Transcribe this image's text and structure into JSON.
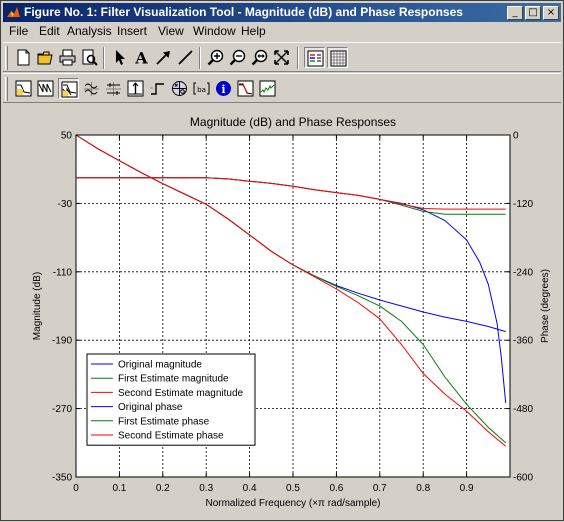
{
  "window": {
    "title": "Figure No. 1: Filter Visualization Tool - Magnitude (dB) and Phase Responses",
    "min_label": "_",
    "max_label": "□",
    "close_label": "×"
  },
  "menu": {
    "items": [
      {
        "label": "File"
      },
      {
        "label": "Edit"
      },
      {
        "label": "Analysis"
      },
      {
        "label": "Insert"
      },
      {
        "label": "View"
      },
      {
        "label": "Window"
      },
      {
        "label": "Help"
      }
    ]
  },
  "toolbar1": [
    "new-figure-icon",
    "open-file-icon",
    "print-icon",
    "print-preview-icon",
    "select-arrow-icon",
    "insert-text-icon",
    "insert-arrow-icon",
    "insert-line-icon",
    "zoom-in-icon",
    "zoom-out-icon",
    "zoom-x-icon",
    "full-view-icon",
    "legend-icon",
    "grid-icon"
  ],
  "toolbar2": [
    "magnitude-response-icon",
    "phase-response-icon",
    "magnitude-phase-icon",
    "group-delay-icon",
    "phase-delay-icon",
    "impulse-response-icon",
    "step-response-icon",
    "pole-zero-icon",
    "coefficients-icon",
    "filter-info-icon",
    "magnitude-estimate-icon",
    "noise-power-icon"
  ],
  "colors": {
    "original": "#0000ff",
    "first": "#008000",
    "second": "#ff0000"
  },
  "chart_data": {
    "type": "line",
    "title": "Magnitude (dB) and Phase Responses",
    "xlabel": "Normalized Frequency (×π rad/sample)",
    "ylabel": "Magnitude (dB)",
    "ylabel_right": "Phase (degrees)",
    "xlim": [
      0,
      1
    ],
    "ylim": [
      -350,
      50
    ],
    "ylim_right": [
      -600,
      0
    ],
    "xticks": [
      "0",
      "0.1",
      "0.2",
      "0.3",
      "0.4",
      "0.5",
      "0.6",
      "0.7",
      "0.8",
      "0.9"
    ],
    "yticks_left": [
      "50",
      "-30",
      "-110",
      "-190",
      "-270",
      "-350"
    ],
    "yticks_right": [
      "0",
      "-120",
      "-240",
      "-360",
      "-480",
      "-600"
    ],
    "grid": true,
    "legend_position": "bottom-left",
    "series": [
      {
        "name": "Original magnitude",
        "axis": "left",
        "color": "#0000ff",
        "x": [
          0,
          0.05,
          0.1,
          0.15,
          0.2,
          0.25,
          0.3,
          0.35,
          0.4,
          0.45,
          0.5,
          0.55,
          0.6,
          0.65,
          0.7,
          0.75,
          0.8,
          0.85,
          0.9,
          0.95,
          0.99
        ],
        "y": [
          50,
          34,
          20,
          6,
          -7,
          -19,
          -31,
          -48,
          -67,
          -86,
          -102,
          -115,
          -126,
          -135,
          -143,
          -150,
          -157,
          -163,
          -168,
          -174,
          -180
        ]
      },
      {
        "name": "First  Estimate magnitude",
        "axis": "left",
        "color": "#008000",
        "x": [
          0,
          0.05,
          0.1,
          0.15,
          0.2,
          0.25,
          0.3,
          0.35,
          0.4,
          0.45,
          0.5,
          0.55,
          0.6,
          0.65,
          0.7,
          0.75,
          0.8,
          0.85,
          0.9,
          0.95,
          0.99
        ],
        "y": [
          50,
          34,
          20,
          6,
          -7,
          -19,
          -31,
          -48,
          -67,
          -86,
          -102,
          -115,
          -127,
          -138,
          -150,
          -168,
          -195,
          -233,
          -265,
          -292,
          -310
        ]
      },
      {
        "name": "Second Estimate magnitude",
        "axis": "left",
        "color": "#ff0000",
        "x": [
          0,
          0.05,
          0.1,
          0.15,
          0.2,
          0.25,
          0.3,
          0.35,
          0.4,
          0.45,
          0.5,
          0.55,
          0.6,
          0.65,
          0.7,
          0.75,
          0.8,
          0.85,
          0.9,
          0.95,
          0.99
        ],
        "y": [
          50,
          34,
          20,
          6,
          -7,
          -19,
          -31,
          -48,
          -67,
          -86,
          -102,
          -116,
          -130,
          -146,
          -165,
          -195,
          -229,
          -253,
          -273,
          -297,
          -314
        ]
      },
      {
        "name": "Original phase",
        "axis": "right",
        "color": "#0000ff",
        "x": [
          0,
          0.1,
          0.2,
          0.3,
          0.35,
          0.4,
          0.45,
          0.5,
          0.55,
          0.6,
          0.65,
          0.7,
          0.75,
          0.8,
          0.85,
          0.9,
          0.93,
          0.95,
          0.97,
          0.98,
          0.99
        ],
        "y": [
          -75,
          -75,
          -75,
          -75,
          -77,
          -81,
          -85,
          -90,
          -96,
          -101,
          -106,
          -113,
          -120,
          -131,
          -150,
          -184,
          -223,
          -262,
          -330,
          -390,
          -470
        ]
      },
      {
        "name": "First Estimate phase",
        "axis": "right",
        "color": "#008000",
        "x": [
          0,
          0.1,
          0.2,
          0.3,
          0.35,
          0.4,
          0.45,
          0.5,
          0.55,
          0.6,
          0.65,
          0.7,
          0.75,
          0.8,
          0.85,
          0.9,
          0.95,
          0.99
        ],
        "y": [
          -75,
          -75,
          -75,
          -75,
          -77,
          -81,
          -85,
          -90,
          -96,
          -101,
          -106,
          -113,
          -123,
          -134,
          -139,
          -139,
          -139,
          -139
        ]
      },
      {
        "name": "Second Estimate phase",
        "axis": "right",
        "color": "#ff0000",
        "x": [
          0,
          0.1,
          0.2,
          0.3,
          0.35,
          0.4,
          0.45,
          0.5,
          0.55,
          0.6,
          0.65,
          0.7,
          0.75,
          0.8,
          0.85,
          0.9,
          0.95,
          0.99
        ],
        "y": [
          -75,
          -75,
          -75,
          -75,
          -77,
          -81,
          -85,
          -90,
          -96,
          -101,
          -106,
          -113,
          -121,
          -129,
          -130,
          -130,
          -130,
          -130
        ]
      }
    ]
  }
}
